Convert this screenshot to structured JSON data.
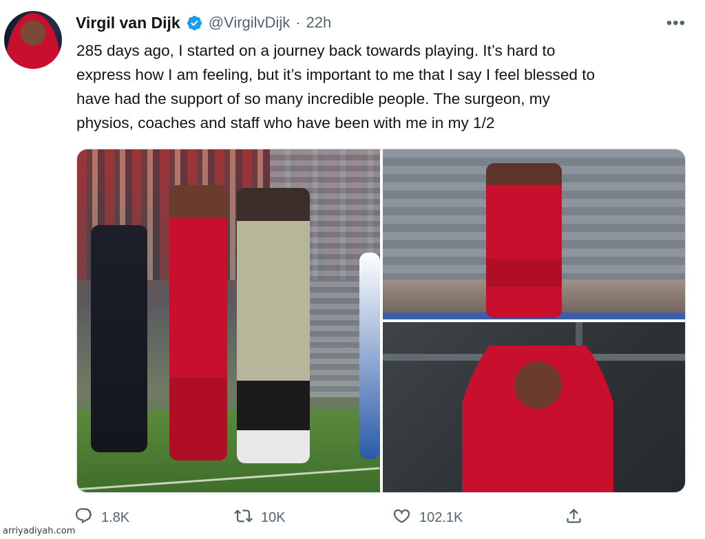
{
  "author": {
    "name": "Virgil van Dijk",
    "handle": "@VirgilvDijk",
    "separator": "·",
    "time": "22h",
    "verified_icon": "verified-badge-icon",
    "avatar": "profile-photo"
  },
  "more_label": "•••",
  "tweet": {
    "text": "285 days ago, I started on a journey back towards playing. It’s hard to\nexpress how I am feeling, but it’s important to me that I say I feel blessed to\nhave had the support of so many incredible people. The surgeon, my\nphysios, coaches and staff who have been with me in my 1/2"
  },
  "media": {
    "photos": [
      {
        "icon": "photo-sideline-embrace"
      },
      {
        "icon": "photo-player-pointing"
      },
      {
        "icon": "photo-player-portrait"
      }
    ]
  },
  "actions": {
    "reply": {
      "icon": "reply-icon",
      "count": "1.8K"
    },
    "retweet": {
      "icon": "retweet-icon",
      "count": "10K"
    },
    "like": {
      "icon": "heart-icon",
      "count": "102.1K"
    },
    "share": {
      "icon": "share-icon"
    }
  },
  "watermark": "arriyadiyah.com",
  "colors": {
    "text": "#0f1419",
    "secondary": "#536471",
    "verified": "#1d9bf0",
    "border": "#cfd9de"
  }
}
